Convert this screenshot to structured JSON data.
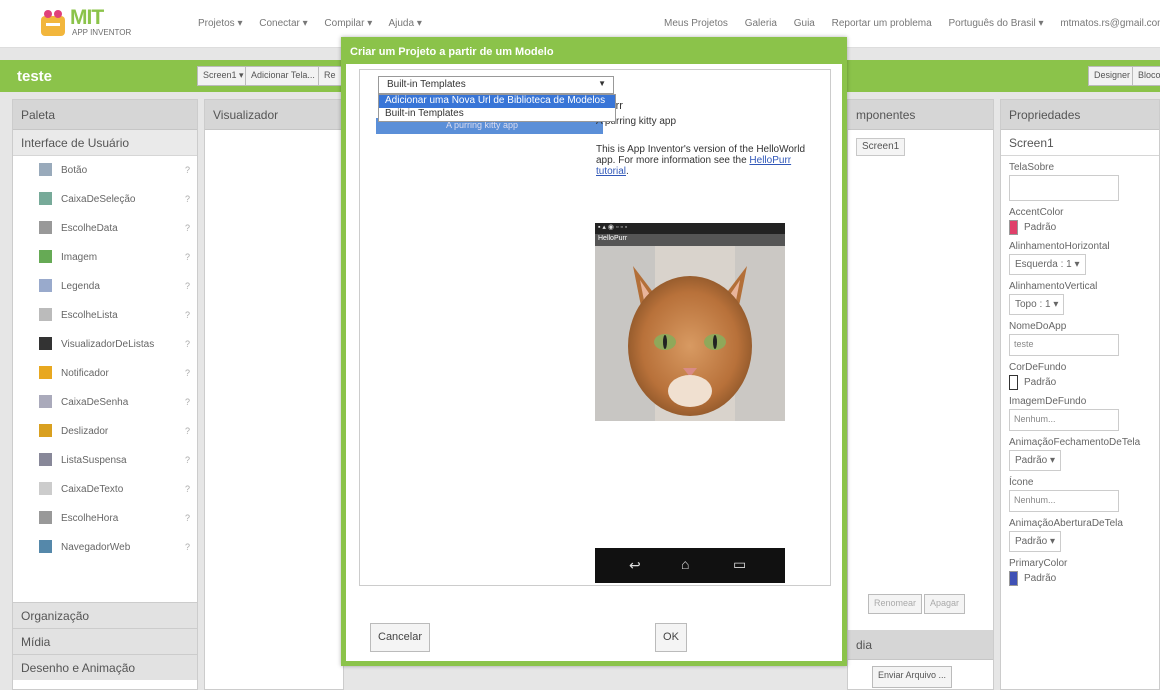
{
  "top": {
    "logo_mit": "MIT",
    "logo_sub": "APP INVENTOR",
    "menu_left": [
      "Projetos ▾",
      "Conectar ▾",
      "Compilar ▾",
      "Ajuda ▾"
    ],
    "menu_right": [
      "Meus Projetos",
      "Galeria",
      "Guia",
      "Reportar um problema",
      "Português do Brasil ▾",
      "mtmatos.rs@gmail.com ▾"
    ]
  },
  "project_bar": {
    "name": "teste",
    "screen_btn": "Screen1 ▾",
    "add_screen_btn": "Adicionar Tela...",
    "remove_btn_partial": "Re",
    "designer_btn": "Designer",
    "blocks_btn": "Bloco"
  },
  "palette": {
    "title": "Paleta",
    "category": "Interface de Usuário",
    "items": [
      {
        "label": "Botão",
        "icon": "button-icon",
        "color": "#9ab"
      },
      {
        "label": "CaixaDeSeleção",
        "icon": "checkbox-icon",
        "color": "#7a9"
      },
      {
        "label": "EscolheData",
        "icon": "datepicker-icon",
        "color": "#999"
      },
      {
        "label": "Imagem",
        "icon": "image-icon",
        "color": "#6a5"
      },
      {
        "label": "Legenda",
        "icon": "label-icon",
        "color": "#9ac"
      },
      {
        "label": "EscolheLista",
        "icon": "listpicker-icon",
        "color": "#bbb"
      },
      {
        "label": "VisualizadorDeListas",
        "icon": "listview-icon",
        "color": "#333"
      },
      {
        "label": "Notificador",
        "icon": "notifier-icon",
        "color": "#e8a820"
      },
      {
        "label": "CaixaDeSenha",
        "icon": "passwordbox-icon",
        "color": "#aab"
      },
      {
        "label": "Deslizador",
        "icon": "slider-icon",
        "color": "#d9a020"
      },
      {
        "label": "ListaSuspensa",
        "icon": "spinner-icon",
        "color": "#889"
      },
      {
        "label": "CaixaDeTexto",
        "icon": "textbox-icon",
        "color": "#ccc"
      },
      {
        "label": "EscolheHora",
        "icon": "timepicker-icon",
        "color": "#999"
      },
      {
        "label": "NavegadorWeb",
        "icon": "webviewer-icon",
        "color": "#58a"
      }
    ],
    "help_glyph": "?",
    "other_categories": [
      "Organização",
      "Mídia",
      "Desenho e Animação"
    ]
  },
  "viewer": {
    "title": "Visualizador"
  },
  "components": {
    "title_partial": "mponentes",
    "screen_item": "Screen1",
    "rename_btn": "Renomear",
    "delete_btn": "Apagar",
    "media_title_partial": "dia",
    "upload_btn": "Enviar Arquivo ..."
  },
  "properties": {
    "title": "Propriedades",
    "selected": "Screen1",
    "fields": {
      "tela_sobre": "TelaSobre",
      "accent_color": "AccentColor",
      "accent_value": "Padrão",
      "align_h": "AlinhamentoHorizontal",
      "align_h_value": "Esquerda : 1 ▾",
      "align_v": "AlinhamentoVertical",
      "align_v_value": "Topo : 1 ▾",
      "app_name": "NomeDoApp",
      "app_name_value": "teste",
      "bg_color": "CorDeFundo",
      "bg_color_value": "Padrão",
      "bg_image": "ImagemDeFundo",
      "bg_image_value": "Nenhum...",
      "close_anim": "AnimaçãoFechamentoDeTela",
      "close_anim_value": "Padrão ▾",
      "icon": "Ícone",
      "icon_value": "Nenhum...",
      "open_anim": "AnimaçãoAberturaDeTela",
      "open_anim_value": "Padrão ▾",
      "primary_color": "PrimaryColor",
      "primary_color_value": "Padrão"
    },
    "colors": {
      "accent": "#e0406a",
      "bg": "#ffffff",
      "primary": "#3f51b5"
    }
  },
  "modal": {
    "title": "Criar um Projeto a partir de um Modelo",
    "select_value": "Built-in Templates",
    "options": [
      "Adicionar uma Nova Url de Biblioteca de Modelos",
      "Built-in Templates"
    ],
    "template_label": "A purring kitty app",
    "app_name_partial": "oPurr",
    "app_tagline": "A purring kitty app",
    "description": "This is App Inventor's version of the HelloWorld app. For more information see the ",
    "link": "HelloPurr tutorial",
    "description_end": ".",
    "phone_title": "HelloPurr",
    "cancel_btn": "Cancelar",
    "ok_btn": "OK"
  },
  "accent": "#8bc34a"
}
